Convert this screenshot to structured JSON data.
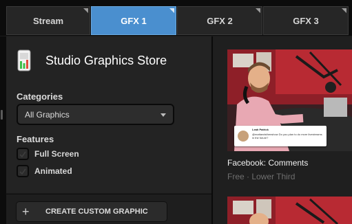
{
  "tabs": [
    {
      "label": "Stream",
      "active": false
    },
    {
      "label": "GFX 1",
      "active": true
    },
    {
      "label": "GFX 2",
      "active": false
    },
    {
      "label": "GFX 3",
      "active": false
    }
  ],
  "store": {
    "title": "Studio Graphics Store",
    "icon": "studio-store-icon"
  },
  "categories": {
    "label": "Categories",
    "selected": "All Graphics"
  },
  "features": {
    "label": "Features",
    "options": [
      {
        "label": "Full Screen",
        "checked": false
      },
      {
        "label": "Animated",
        "checked": false
      }
    ]
  },
  "create_button": {
    "icon": "+",
    "label": "CREATE CUSTOM GRAPHIC"
  },
  "cards": [
    {
      "title": "Facebook: Comments",
      "meta": "Free · Lower Third",
      "overlay": {
        "name": "Leah Patrick",
        "text": "@mattandsthenshow Do you plan to do more livestreams in the future?"
      }
    }
  ],
  "colors": {
    "accent": "#4a8fcf",
    "background": "#1b1b1b",
    "panel": "#232323"
  }
}
